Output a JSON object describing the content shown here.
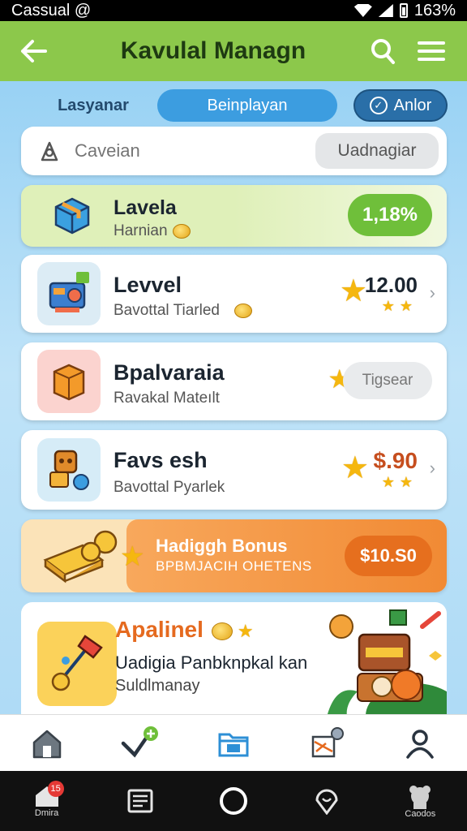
{
  "status_bar": {
    "left_text": "Cassual @",
    "battery": "163%"
  },
  "header": {
    "title": "Kavulal Managn"
  },
  "tabs": [
    {
      "label": "Lasyanar"
    },
    {
      "label": "Beinplayan"
    },
    {
      "label": "Anlor"
    }
  ],
  "search": {
    "placeholder": "Caveian",
    "button_label": "Uadnagiar"
  },
  "items": [
    {
      "title": "Lavela",
      "subtitle": "Harnian",
      "badge": "1,18%"
    },
    {
      "title": "Levvel",
      "subtitle": "Bavottal Tiarled",
      "price": "12.00"
    },
    {
      "title": "Bpalvaraia",
      "subtitle": "Ravakal Mateılt",
      "badge": "Tigsear"
    },
    {
      "title": "Favs esh",
      "subtitle": "Bavottal Pyarlek",
      "price": "$.90"
    }
  ],
  "bonus": {
    "title": "Hadiggh Bonus",
    "subtitle": "BPBMJACIH OHETENS",
    "button_label": "$10.S0"
  },
  "feature": {
    "title": "Apalinel",
    "description": "Uadigia Panbknpkal kan",
    "subtitle": "Suldlmanay"
  },
  "system_nav": {
    "left_label": "Dmira",
    "badge": "15",
    "right_label": "Caodos"
  },
  "colors": {
    "header_green": "#8cc84b",
    "accent_blue": "#3c9de0",
    "badge_green": "#6fbf3a",
    "bonus_orange": "#e66f1e"
  }
}
